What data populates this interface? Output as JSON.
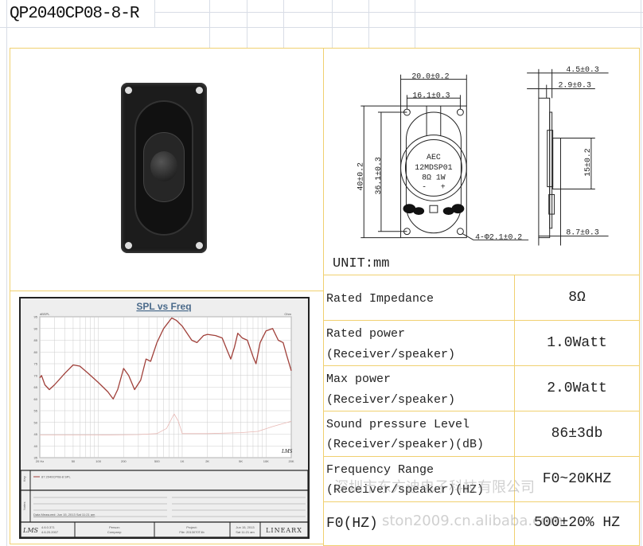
{
  "title": "QP2040CP08-8-R",
  "drawing": {
    "dims": {
      "width_outer": "20.0±0.2",
      "width_holes": "16.1±0.3",
      "height_outer": "40±0.2",
      "height_holes": "36.1±0.3",
      "holes": "4-Φ2.1±0.2",
      "depth_total": "4.5±0.3",
      "depth_frame": "2.9±0.3",
      "side_height": "15±0.2",
      "side_depth": "8.7±0.3"
    },
    "label_lines": [
      "AEC",
      "12MDSP01",
      "8Ω  1W",
      "-   +"
    ],
    "unit": "UNIT:mm"
  },
  "specs": [
    {
      "label_1": "Rated Impedance",
      "label_2": "",
      "value": "8Ω"
    },
    {
      "label_1": "Rated power",
      "label_2": "(Receiver/speaker)",
      "value": "1.0Watt"
    },
    {
      "label_1": "Max power",
      "label_2": "(Receiver/speaker)",
      "value": "2.0Watt"
    },
    {
      "label_1": "Sound pressure Level",
      "label_2": "(Receiver/speaker)(dB)",
      "value": "86±3db"
    },
    {
      "label_1": "Frequency Range",
      "label_2": "(Receiver/speaker)(HZ)",
      "value": "F0~20KHZ"
    },
    {
      "label_1": "F0(HZ)",
      "label_2": "",
      "value": "500±20% HZ"
    }
  ],
  "watermark": {
    "line_1": "深圳市东方迪电子科技有限公司",
    "line_2": "ston2009.cn.alibaba.com"
  },
  "chart_data": {
    "type": "line",
    "title": "SPL vs Freq",
    "ylabel": "dBSPL",
    "y2label": "Ohm",
    "xscale": "log",
    "xlim": [
      20,
      20000
    ],
    "ylim": [
      35,
      95
    ],
    "y2lim": [
      4,
      200
    ],
    "y2scale": "log",
    "grid": true,
    "x_ticks": [
      {
        "v": 20,
        "label": "20 Hz"
      },
      {
        "v": 50,
        "label": "50"
      },
      {
        "v": 100,
        "label": "100"
      },
      {
        "v": 200,
        "label": "200"
      },
      {
        "v": 500,
        "label": "500"
      },
      {
        "v": 1000,
        "label": "1K"
      },
      {
        "v": 2000,
        "label": "2K"
      },
      {
        "v": 5000,
        "label": "5K"
      },
      {
        "v": 10000,
        "label": "10K"
      },
      {
        "v": 20000,
        "label": "20K"
      }
    ],
    "y_ticks": [
      95,
      90,
      85,
      80,
      75,
      70,
      65,
      60,
      55,
      50,
      45,
      40,
      35
    ],
    "series": [
      {
        "name": "87  2040CP08-8 SPL",
        "color": "#a0403a",
        "x": [
          20,
          21,
          23,
          26,
          30,
          40,
          50,
          60,
          75,
          100,
          130,
          150,
          170,
          200,
          230,
          270,
          320,
          370,
          420,
          500,
          600,
          750,
          850,
          1000,
          1300,
          1500,
          1800,
          2000,
          2500,
          3000,
          3500,
          3800,
          4200,
          4600,
          5200,
          6000,
          7000,
          7600,
          8500,
          10000,
          12000,
          14000,
          16000,
          17500,
          20000
        ],
        "y": [
          69,
          70,
          66,
          64,
          66,
          71,
          74.5,
          74,
          71,
          67,
          63,
          60,
          64,
          73,
          70,
          64,
          68,
          77,
          76,
          84,
          90,
          94.5,
          93.5,
          91,
          85,
          84,
          87,
          87.5,
          87,
          86,
          80,
          77,
          82,
          88,
          86,
          85,
          78,
          75,
          84,
          89,
          90,
          85,
          84,
          79,
          72
        ]
      },
      {
        "color": "#e8b8b4",
        "axis": "right",
        "x": [
          20,
          100,
          300,
          500,
          650,
          800,
          900,
          1000,
          2000,
          5000,
          8000,
          12000,
          20000
        ],
        "y": [
          7.5,
          7.5,
          7.6,
          7.8,
          9,
          13.5,
          11,
          7.8,
          7.8,
          8,
          8.3,
          9.5,
          11
        ]
      }
    ],
    "right_corner_logo": "LMS",
    "legend": "below",
    "notes": "Data Measured: Jun 15, 2013  Sat 11:21 am",
    "footer": {
      "logo": "LMS",
      "version": "4.6.0.371",
      "date_code": "4.6.20.2007",
      "person": "Person:",
      "company": "Company:",
      "project": "Project:",
      "file": "File: 2013070T.lib",
      "date": "Jun 15, 2013",
      "time": "Sat 11:21 am",
      "brand": "LINEARX"
    },
    "side_label_legend": "Key",
    "side_label_notes": "Notes"
  }
}
